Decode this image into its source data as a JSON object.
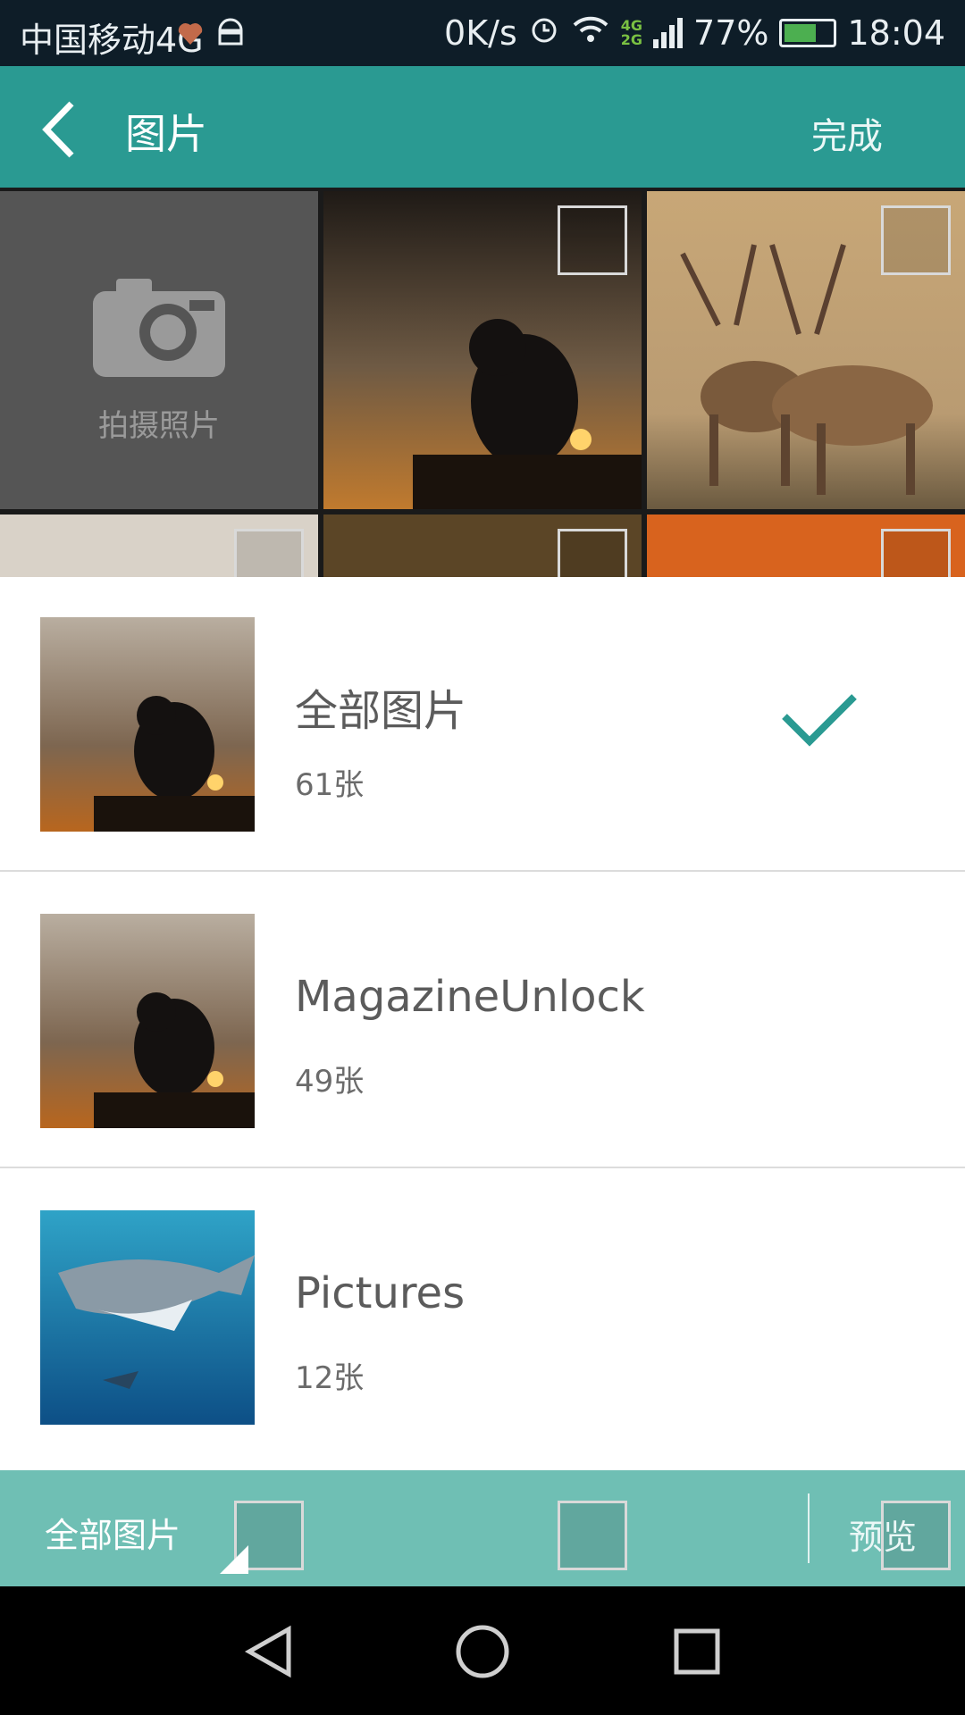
{
  "status_bar": {
    "carrier": "中国移动4G",
    "speed": "0K/s",
    "network_top": "4G",
    "network_bottom": "2G",
    "battery": "77%",
    "battery_level": 0.77,
    "time": "18:04",
    "icons": [
      "heart-icon",
      "android-icon",
      "alarm-icon",
      "wifi-icon",
      "signal-icon",
      "battery-icon"
    ]
  },
  "header": {
    "title": "图片",
    "done_label": "完成"
  },
  "grid": {
    "camera_label": "拍摄照片",
    "tiles": [
      "cat-sunset-photo",
      "deer-photo",
      "tree-photo",
      "doorway-photo",
      "portal-photo"
    ]
  },
  "albums": [
    {
      "name": "全部图片",
      "count": "61张",
      "selected": true,
      "thumb": "cat-sunset"
    },
    {
      "name": "MagazineUnlock",
      "count": "49张",
      "selected": false,
      "thumb": "cat-sunset"
    },
    {
      "name": "Pictures",
      "count": "12张",
      "selected": false,
      "thumb": "shark"
    }
  ],
  "bottom_bar": {
    "album_label": "全部图片",
    "preview_label": "预览"
  },
  "colors": {
    "accent": "#2a9a92",
    "check": "#2a9a92"
  }
}
